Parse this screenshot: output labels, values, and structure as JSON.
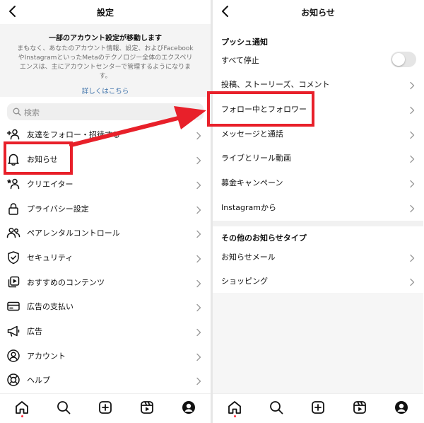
{
  "left": {
    "title": "設定",
    "notice": {
      "title": "一部のアカウント設定が移動します",
      "body_lines": [
        "まもなく、あなたのアカウント情報、設定、およびFacebook",
        "やInstagramといったMetaのテクノロジー全体のエクスペリ",
        "エンスは、主にアカウントセンターで管理するようになりま",
        "す。"
      ],
      "link": "詳しくはこちら"
    },
    "search_placeholder": "検索",
    "items": [
      {
        "label": "友達をフォロー・招待する",
        "icon": "add-user-icon"
      },
      {
        "label": "お知らせ",
        "icon": "bell-icon"
      },
      {
        "label": "クリエイター",
        "icon": "creator-icon"
      },
      {
        "label": "プライバシー設定",
        "icon": "lock-icon"
      },
      {
        "label": "ペアレンタルコントロール",
        "icon": "people-icon"
      },
      {
        "label": "セキュリティ",
        "icon": "shield-icon"
      },
      {
        "label": "おすすめのコンテンツ",
        "icon": "media-icon"
      },
      {
        "label": "広告の支払い",
        "icon": "card-icon"
      },
      {
        "label": "広告",
        "icon": "megaphone-icon"
      },
      {
        "label": "アカウント",
        "icon": "account-icon"
      },
      {
        "label": "ヘルプ",
        "icon": "lifebuoy-icon"
      }
    ]
  },
  "right": {
    "title": "お知らせ",
    "push_section": "プッシュ通知",
    "pause_all": "すべて停止",
    "push_items": [
      "投稿、ストーリーズ、コメント",
      "フォロー中とフォロワー",
      "メッセージと通話",
      "ライブとリール動画",
      "募金キャンペーン",
      "Instagramから"
    ],
    "other_section": "その他のお知らせタイプ",
    "other_items": [
      "お知らせメール",
      "ショッピング"
    ]
  },
  "tabs": [
    "home-icon",
    "search-icon",
    "create-icon",
    "reels-icon",
    "profile-icon"
  ],
  "colors": {
    "highlight": "#e8202a",
    "link": "#3a6fa8",
    "notification_dot": "#ff3040"
  }
}
